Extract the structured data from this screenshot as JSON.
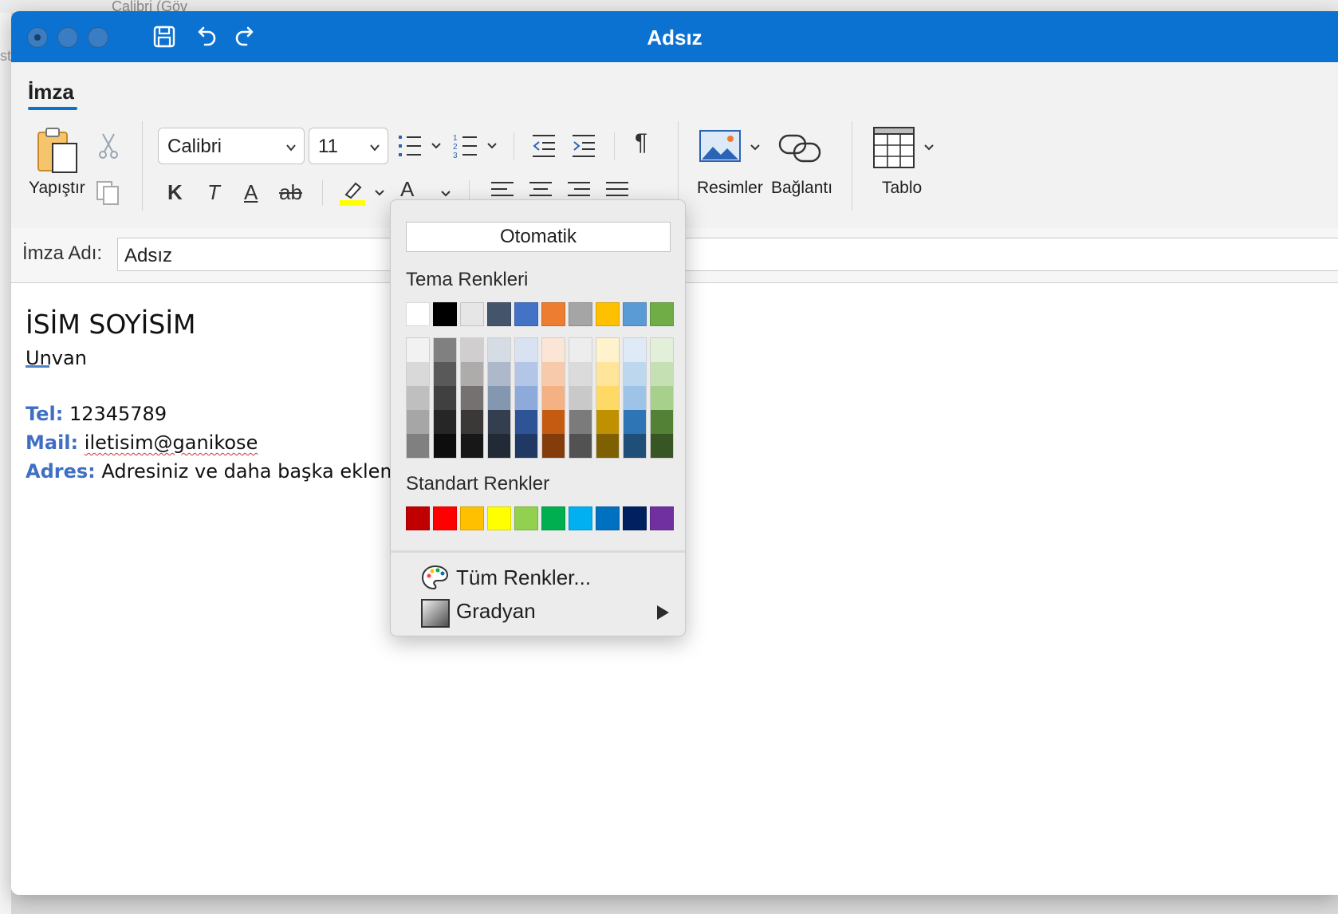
{
  "background": {
    "partial_font_text": "Calibri (Göv",
    "partial_side_text": "st"
  },
  "window": {
    "title": "Adsız",
    "titlebar_color": "#0c72d2"
  },
  "ribbon": {
    "tab": "İmza",
    "paste_label": "Yapıştır",
    "font_name": "Calibri",
    "font_size": "11",
    "format_buttons": {
      "bold": "K",
      "italic": "T",
      "underline": "A",
      "strikethrough": "ab"
    },
    "pictures_label": "Resimler",
    "link_label": "Bağlantı",
    "table_label": "Tablo",
    "highlight_color": "#ffff00",
    "font_color": "#ed7d31"
  },
  "signature_name": {
    "label": "İmza Adı:",
    "value": "Adsız"
  },
  "document": {
    "name": "İSİM SOYİSİM",
    "title": "Unvan",
    "tel_label": "Tel:",
    "tel_value": "12345789",
    "mail_label": "Mail:",
    "mail_value": "iletisim@ganikose",
    "address_label": "Adres:",
    "address_value": "Adresiniz ve daha başka eklemek"
  },
  "color_picker": {
    "automatic_label": "Otomatik",
    "theme_label": "Tema Renkleri",
    "standard_label": "Standart Renkler",
    "all_colors_label": "Tüm Renkler...",
    "gradient_label": "Gradyan",
    "theme_colors": [
      "#ffffff",
      "#000000",
      "#e7e6e6",
      "#44546a",
      "#4472c4",
      "#ed7d31",
      "#a5a5a5",
      "#ffc000",
      "#5b9bd5",
      "#70ad47"
    ],
    "theme_shades": [
      [
        "#f2f2f2",
        "#d9d9d9",
        "#bfbfbf",
        "#a6a6a6",
        "#808080"
      ],
      [
        "#808080",
        "#595959",
        "#404040",
        "#262626",
        "#0d0d0d"
      ],
      [
        "#d0cece",
        "#aeabab",
        "#767171",
        "#3b3838",
        "#181717"
      ],
      [
        "#d6dce4",
        "#adb9ca",
        "#8497b0",
        "#333f4f",
        "#222a35"
      ],
      [
        "#d9e2f3",
        "#b4c6e7",
        "#8eaadb",
        "#2f5496",
        "#1f3864"
      ],
      [
        "#fbe5d5",
        "#f7caac",
        "#f4b183",
        "#c55a11",
        "#843c0b"
      ],
      [
        "#ededed",
        "#dbdbdb",
        "#c9c9c9",
        "#7b7b7b",
        "#525252"
      ],
      [
        "#fff2cc",
        "#ffe599",
        "#ffd966",
        "#bf9000",
        "#7f6000"
      ],
      [
        "#deebf6",
        "#bdd7ee",
        "#9dc3e6",
        "#2e75b5",
        "#1f4e79"
      ],
      [
        "#e2efd9",
        "#c5e0b3",
        "#a8d08d",
        "#538135",
        "#375623"
      ]
    ],
    "standard_colors": [
      "#c00000",
      "#ff0000",
      "#ffc000",
      "#ffff00",
      "#92d050",
      "#00b050",
      "#00b0f0",
      "#0070c0",
      "#002060",
      "#7030a0"
    ]
  }
}
